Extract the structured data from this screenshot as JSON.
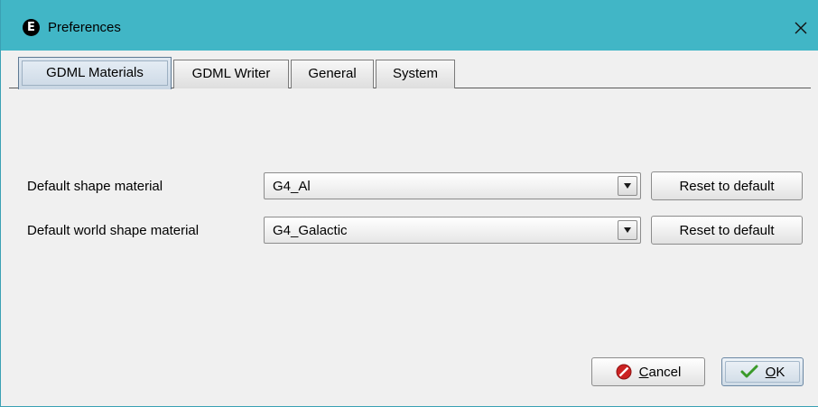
{
  "window": {
    "title": "Preferences",
    "app_icon_letter": "E",
    "close_glyph": "✕"
  },
  "tabs": [
    {
      "label": "GDML Materials",
      "active": true
    },
    {
      "label": "GDML Writer",
      "active": false
    },
    {
      "label": "General",
      "active": false
    },
    {
      "label": "System",
      "active": false
    }
  ],
  "settings": {
    "shape_material": {
      "label": "Default shape material",
      "value": "G4_Al",
      "reset_label": "Reset to default"
    },
    "world_material": {
      "label": "Default world shape material",
      "value": "G4_Galactic",
      "reset_label": "Reset to default"
    }
  },
  "footer": {
    "cancel_label": "Cancel",
    "ok_label": "OK"
  },
  "colors": {
    "titlebar": "#41b6c6",
    "cancel_icon": "#cc2222",
    "ok_icon": "#3a9a2a"
  },
  "icons": {
    "app": "app-e-icon",
    "close": "close-icon",
    "dropdown": "chevron-down-icon",
    "cancel": "cancel-icon",
    "ok": "checkmark-icon"
  }
}
